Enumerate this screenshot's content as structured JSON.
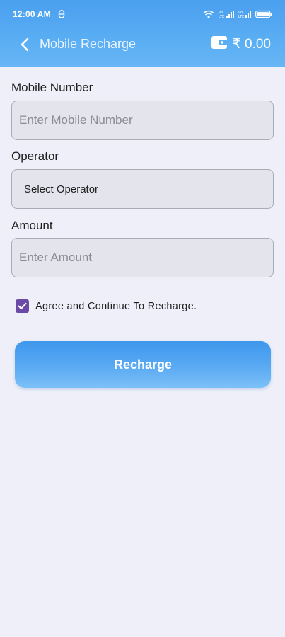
{
  "status_bar": {
    "time": "12:00 AM",
    "indicators": [
      "wifi-icon",
      "volte-signal-icon",
      "volte-signal-icon",
      "battery-icon"
    ]
  },
  "app_bar": {
    "title": "Mobile Recharge",
    "wallet_balance": "₹ 0.00"
  },
  "form": {
    "mobile_label": "Mobile Number",
    "mobile_placeholder": "Enter Mobile Number",
    "mobile_value": "",
    "operator_label": "Operator",
    "operator_selected": "Select Operator",
    "amount_label": "Amount",
    "amount_placeholder": "Enter Amount",
    "amount_value": "",
    "agree_text": "Agree and Continue To Recharge.",
    "agree_checked": true,
    "submit_label": "Recharge"
  },
  "colors": {
    "header": "#5aaef3",
    "background": "#eeeff8",
    "checkbox": "#6a4aa6",
    "button": "#4ea2f0"
  }
}
